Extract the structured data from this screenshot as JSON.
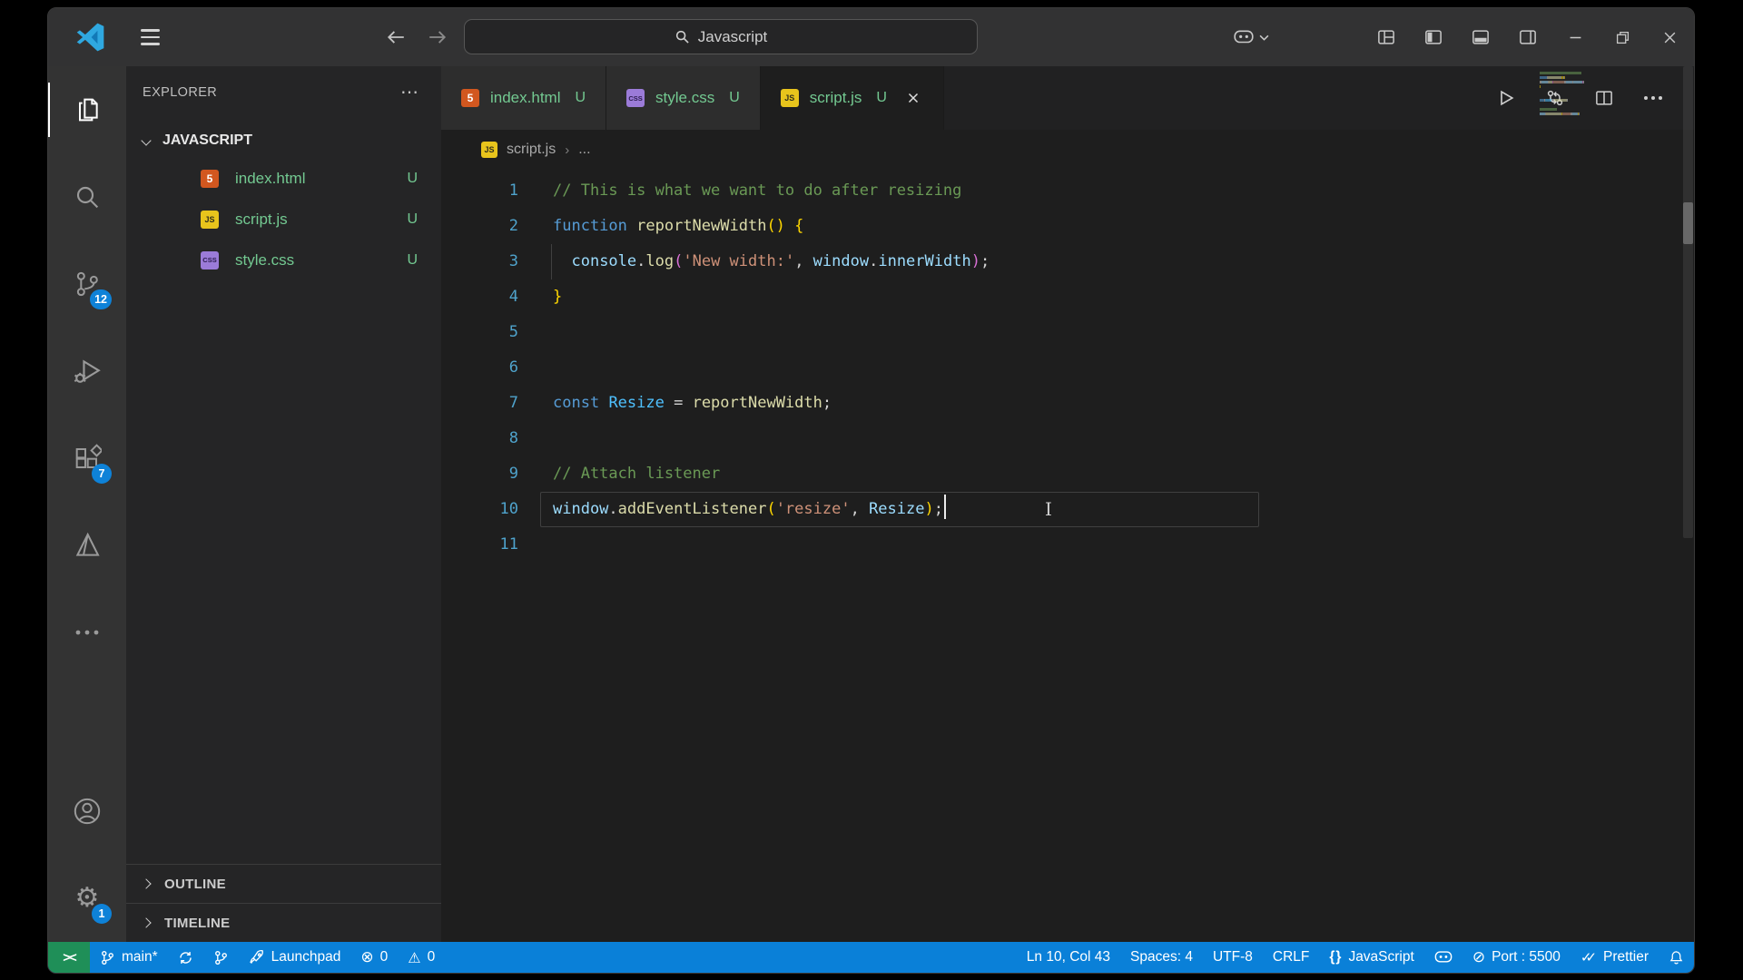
{
  "titlebar": {
    "search": {
      "text": "Javascript"
    }
  },
  "activity_bar": {
    "top": [
      {
        "id": "explorer",
        "active": true,
        "badge": ""
      },
      {
        "id": "search",
        "badge": ""
      },
      {
        "id": "source-control",
        "badge": "12"
      },
      {
        "id": "run-debug",
        "badge": ""
      },
      {
        "id": "extensions",
        "badge": "7"
      },
      {
        "id": "live-server",
        "badge": ""
      },
      {
        "id": "more",
        "badge": ""
      }
    ],
    "bottom": [
      {
        "id": "accounts",
        "badge": ""
      },
      {
        "id": "settings",
        "badge": "1"
      }
    ]
  },
  "sidebar": {
    "title": "EXPLORER",
    "more_label": "⋯",
    "section": {
      "label": "JAVASCRIPT"
    },
    "files": [
      {
        "name": "index.html",
        "type": "html",
        "type_label": "5",
        "status": "U"
      },
      {
        "name": "script.js",
        "type": "js",
        "type_label": "JS",
        "status": "U"
      },
      {
        "name": "style.css",
        "type": "css",
        "type_label": "CSS",
        "status": "U"
      }
    ],
    "panels": [
      {
        "label": "OUTLINE"
      },
      {
        "label": "TIMELINE"
      }
    ]
  },
  "tabs": [
    {
      "name": "index.html",
      "type": "html",
      "type_label": "5",
      "status": "U",
      "active": false
    },
    {
      "name": "style.css",
      "type": "css",
      "type_label": "CSS",
      "status": "U",
      "active": false
    },
    {
      "name": "script.js",
      "type": "js",
      "type_label": "JS",
      "status": "U",
      "active": true
    }
  ],
  "editor_actions": [
    {
      "id": "run"
    },
    {
      "id": "compare-changes"
    },
    {
      "id": "split-editor"
    },
    {
      "id": "more-actions"
    }
  ],
  "breadcrumb": {
    "file": "script.js",
    "file_type": "js",
    "file_type_label": "JS",
    "more": "..."
  },
  "editor": {
    "cursor": {
      "line": 10,
      "col": 43
    },
    "lines": [
      {
        "n": "1",
        "tokens": [
          [
            "comment",
            "// This is what we want to do after resizing"
          ]
        ]
      },
      {
        "n": "2",
        "tokens": [
          [
            "keyword",
            "function"
          ],
          [
            "plain",
            " "
          ],
          [
            "func",
            "reportNewWidth"
          ],
          [
            "b1",
            "()"
          ],
          [
            "plain",
            " "
          ],
          [
            "b1",
            "{"
          ]
        ]
      },
      {
        "n": "3",
        "guide": true,
        "tokens": [
          [
            "plain",
            "  "
          ],
          [
            "var",
            "console"
          ],
          [
            "plain",
            "."
          ],
          [
            "func",
            "log"
          ],
          [
            "b2",
            "("
          ],
          [
            "string",
            "'New width:'"
          ],
          [
            "plain",
            ", "
          ],
          [
            "var",
            "window"
          ],
          [
            "plain",
            "."
          ],
          [
            "var",
            "innerWidth"
          ],
          [
            "b2",
            ")"
          ],
          [
            "plain",
            ";"
          ]
        ]
      },
      {
        "n": "4",
        "tokens": [
          [
            "b1",
            "}"
          ]
        ]
      },
      {
        "n": "5",
        "tokens": []
      },
      {
        "n": "6",
        "tokens": []
      },
      {
        "n": "7",
        "tokens": [
          [
            "keyword",
            "const"
          ],
          [
            "plain",
            " "
          ],
          [
            "const",
            "Resize"
          ],
          [
            "plain",
            " = "
          ],
          [
            "func",
            "reportNewWidth"
          ],
          [
            "plain",
            ";"
          ]
        ]
      },
      {
        "n": "8",
        "tokens": []
      },
      {
        "n": "9",
        "tokens": [
          [
            "comment",
            "// Attach listener"
          ]
        ]
      },
      {
        "n": "10",
        "current": true,
        "cursor": true,
        "ibeam": true,
        "tokens": [
          [
            "var",
            "window"
          ],
          [
            "plain",
            "."
          ],
          [
            "func",
            "addEventListener"
          ],
          [
            "b1",
            "("
          ],
          [
            "string",
            "'resize'"
          ],
          [
            "plain",
            ", "
          ],
          [
            "var",
            "Resize"
          ],
          [
            "b1",
            ")"
          ],
          [
            "plain",
            ";"
          ]
        ]
      },
      {
        "n": "11",
        "tokens": []
      }
    ]
  },
  "status_bar": {
    "left": [
      {
        "id": "remote",
        "icon": "remote",
        "label": ""
      },
      {
        "id": "git-branch",
        "icon": "git-branch",
        "label": "main*"
      },
      {
        "id": "sync",
        "icon": "sync",
        "label": ""
      },
      {
        "id": "gitlens",
        "icon": "git-branch",
        "label": ""
      },
      {
        "id": "launchpad",
        "icon": "rocket",
        "label": "Launchpad"
      },
      {
        "id": "errors",
        "icon": "error",
        "label": "0"
      },
      {
        "id": "warnings",
        "icon": "warning",
        "label": "0"
      }
    ],
    "right": [
      {
        "id": "cursor-position",
        "icon": "",
        "label": "Ln 10, Col 43"
      },
      {
        "id": "indentation",
        "icon": "",
        "label": "Spaces: 4"
      },
      {
        "id": "encoding",
        "icon": "",
        "label": "UTF-8"
      },
      {
        "id": "eol",
        "icon": "",
        "label": "CRLF"
      },
      {
        "id": "language-mode",
        "icon": "braces",
        "label": "JavaScript"
      },
      {
        "id": "copilot",
        "icon": "copilot",
        "label": ""
      },
      {
        "id": "port",
        "icon": "blocked",
        "label": "Port : 5500"
      },
      {
        "id": "prettier",
        "icon": "check-double",
        "label": "Prettier"
      },
      {
        "id": "notifications",
        "icon": "bell",
        "label": ""
      }
    ]
  },
  "colors": {
    "status_bar": "#0a80d8",
    "remote_indicator": "#1f8f58",
    "badge": "#0e82d8",
    "untracked_green": "#73C991",
    "editor_bg": "#1e1e1e",
    "titlebar_bg": "#323233"
  }
}
